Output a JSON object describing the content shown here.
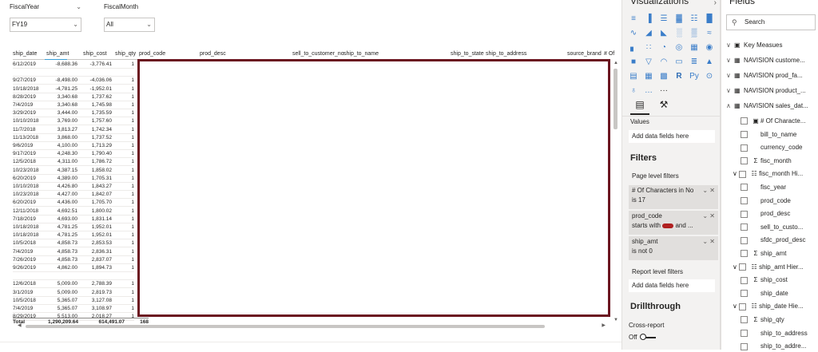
{
  "slicers": [
    {
      "title": "FiscalYear",
      "value": "FY19"
    },
    {
      "title": "FiscalMonth",
      "value": "All"
    }
  ],
  "table": {
    "headers": [
      "ship_date",
      "ship_amt",
      "ship_cost",
      "ship_qty",
      "prod_code",
      "prod_desc",
      "sell_to_customer_no",
      "ship_to_name",
      "ship_to_state",
      "ship_to_address",
      "source_brand",
      "# Of"
    ],
    "rows": [
      [
        "6/12/2019",
        "-8,688.36",
        "-3,776.41",
        "1"
      ],
      [
        "",
        "",
        "",
        ""
      ],
      [
        "9/27/2019",
        "-8,498.00",
        "-4,036.06",
        "1"
      ],
      [
        "10/18/2018",
        "-4,781.25",
        "-1,952.01",
        "1"
      ],
      [
        "8/28/2019",
        "3,340.68",
        "1,737.62",
        "1"
      ],
      [
        "7/4/2019",
        "3,340.68",
        "1,745.98",
        "1"
      ],
      [
        "3/29/2019",
        "3,444.00",
        "1,735.59",
        "1"
      ],
      [
        "10/10/2018",
        "3,769.00",
        "1,757.60",
        "1"
      ],
      [
        "11/7/2018",
        "3,813.27",
        "1,742.34",
        "1"
      ],
      [
        "11/13/2018",
        "3,868.00",
        "1,737.52",
        "1"
      ],
      [
        "9/6/2019",
        "4,100.00",
        "1,713.29",
        "1"
      ],
      [
        "9/17/2019",
        "4,248.30",
        "1,790.40",
        "1"
      ],
      [
        "12/5/2018",
        "4,311.00",
        "1,786.72",
        "1"
      ],
      [
        "10/23/2018",
        "4,387.15",
        "1,858.02",
        "1"
      ],
      [
        "6/20/2019",
        "4,389.00",
        "1,705.31",
        "1"
      ],
      [
        "10/10/2018",
        "4,426.80",
        "1,843.27",
        "1"
      ],
      [
        "10/23/2018",
        "4,427.00",
        "1,842.07",
        "1"
      ],
      [
        "6/20/2019",
        "4,436.00",
        "1,705.70",
        "1"
      ],
      [
        "12/11/2018",
        "4,692.51",
        "1,800.02",
        "1"
      ],
      [
        "7/18/2019",
        "4,693.00",
        "1,831.14",
        "1"
      ],
      [
        "10/18/2018",
        "4,781.25",
        "1,952.01",
        "1"
      ],
      [
        "10/18/2018",
        "4,781.25",
        "1,952.01",
        "1"
      ],
      [
        "10/5/2018",
        "4,858.73",
        "2,853.53",
        "1"
      ],
      [
        "7/4/2019",
        "4,858.73",
        "2,836.31",
        "1"
      ],
      [
        "7/26/2019",
        "4,858.73",
        "2,837.07",
        "1"
      ],
      [
        "9/26/2019",
        "4,862.00",
        "1,894.73",
        "1"
      ],
      [
        "",
        "",
        "",
        ""
      ],
      [
        "12/6/2018",
        "5,009.00",
        "2,788.39",
        "1"
      ],
      [
        "3/1/2019",
        "5,009.00",
        "2,819.73",
        "1"
      ],
      [
        "10/5/2018",
        "5,365.07",
        "3,127.08",
        "1"
      ],
      [
        "7/4/2019",
        "5,365.07",
        "3,108.97",
        "1"
      ],
      [
        "8/29/2019",
        "5,513.00",
        "2,018.27",
        "1"
      ]
    ],
    "totals": {
      "label": "Total",
      "ship_amt": "1,290,209.64",
      "ship_cost": "614,491.07",
      "ship_qty": "168"
    }
  },
  "viz_pane": {
    "title": "Visualizations",
    "icons": [
      "stacked-bar-icon",
      "stacked-column-icon",
      "clustered-bar-icon",
      "clustered-column-icon",
      "100-bar-icon",
      "100-column-icon",
      "line-chart-icon",
      "area-chart-icon",
      "stacked-area-icon",
      "line-column-icon",
      "line-clustered-icon",
      "ribbon-chart-icon",
      "waterfall-icon",
      "scatter-icon",
      "pie-icon",
      "donut-icon",
      "treemap-icon",
      "map-icon",
      "filled-map-icon",
      "funnel-icon",
      "gauge-icon",
      "card-icon",
      "multirow-card-icon",
      "kpi-icon",
      "slicer-icon",
      "table-icon",
      "matrix-icon",
      "r-visual-icon",
      "python-visual-icon",
      "key-influencers-icon",
      "globe-icon",
      "qa-icon",
      "more-icon"
    ],
    "values_label": "Values",
    "values_placeholder": "Add data fields here",
    "filters_title": "Filters",
    "page_level_label": "Page level filters",
    "filters": [
      {
        "line1": "# Of Characters in No",
        "line2": "is 17"
      },
      {
        "line1": "prod_code",
        "line2": "starts with",
        "line2b": "and ..."
      },
      {
        "line1": "ship_amt",
        "line2": "is not 0"
      }
    ],
    "report_level_label": "Report level filters",
    "report_placeholder": "Add data fields here",
    "drill_title": "Drillthrough",
    "cross_report": "Cross-report",
    "toggle_off": "Off",
    "accent": "#6b1520"
  },
  "fields_pane": {
    "title": "Fields",
    "search_placeholder": "Search",
    "tables": [
      {
        "name": "Key Measues",
        "expanded": false
      },
      {
        "name": "NAVISION custome...",
        "expanded": false
      },
      {
        "name": "NAVISION prod_fa...",
        "expanded": false
      },
      {
        "name": "NAVISION product_...",
        "expanded": false
      },
      {
        "name": "NAVISION sales_dat...",
        "expanded": true
      }
    ],
    "fields": [
      {
        "name": "# Of Characte...",
        "kind": "measure"
      },
      {
        "name": "bill_to_name",
        "kind": "text"
      },
      {
        "name": "currency_code",
        "kind": "text"
      },
      {
        "name": "fisc_month",
        "kind": "sum"
      },
      {
        "name": "fisc_month Hi...",
        "kind": "hierarchy"
      },
      {
        "name": "fisc_year",
        "kind": "text"
      },
      {
        "name": "prod_code",
        "kind": "text"
      },
      {
        "name": "prod_desc",
        "kind": "text"
      },
      {
        "name": "sell_to_custo...",
        "kind": "text"
      },
      {
        "name": "sfdc_prod_desc",
        "kind": "text"
      },
      {
        "name": "ship_amt",
        "kind": "sum"
      },
      {
        "name": "ship_amt Hier...",
        "kind": "hierarchy"
      },
      {
        "name": "ship_cost",
        "kind": "sum"
      },
      {
        "name": "ship_date",
        "kind": "text"
      },
      {
        "name": "ship_date Hie...",
        "kind": "hierarchy"
      },
      {
        "name": "ship_qty",
        "kind": "sum"
      },
      {
        "name": "ship_to_address",
        "kind": "text"
      },
      {
        "name": "ship_to_addre...",
        "kind": "text"
      }
    ]
  }
}
